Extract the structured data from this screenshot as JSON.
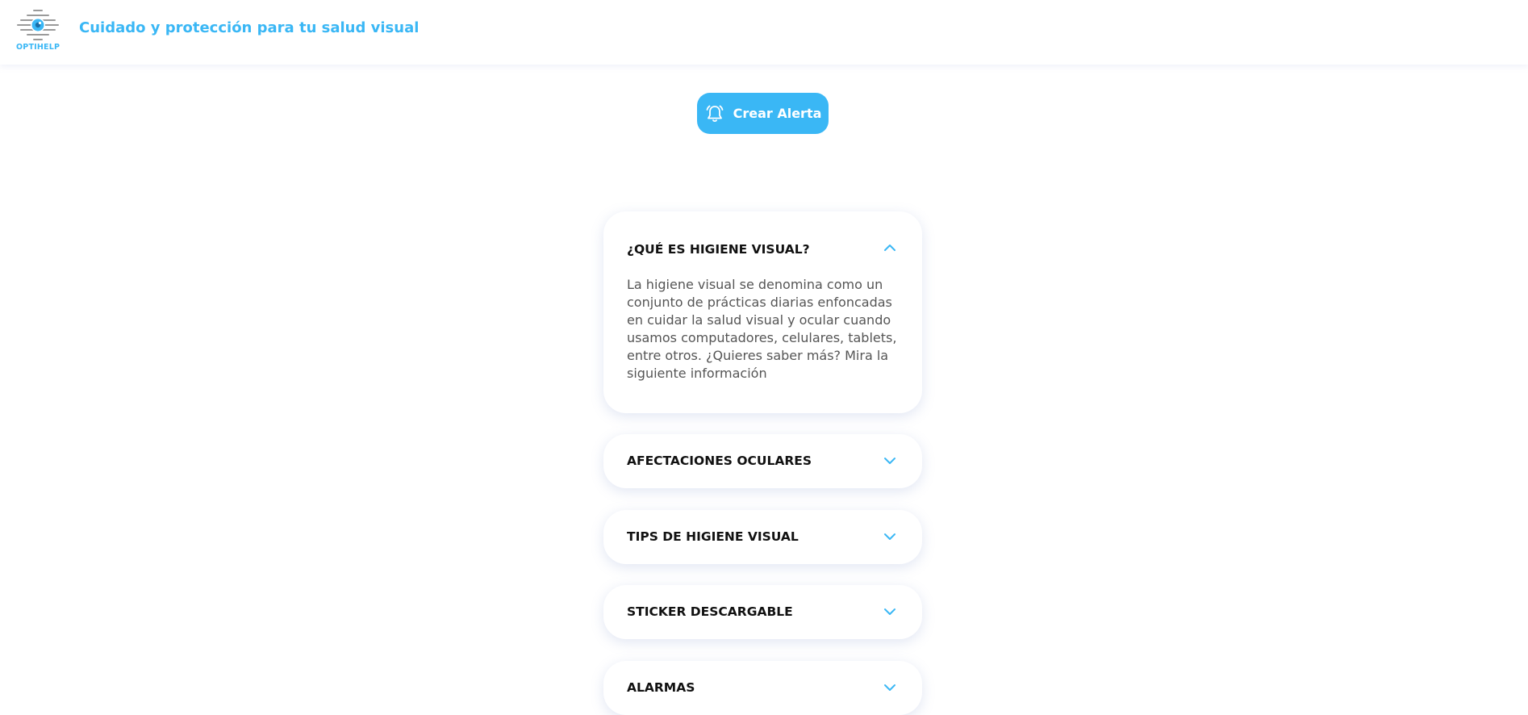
{
  "header": {
    "logo_text": "OPTIHELP",
    "tagline": "Cuidado y protección para tu salud visual"
  },
  "alert_button": {
    "label": "Crear Alerta",
    "icon": "bell-icon"
  },
  "accordion": [
    {
      "title": "¿QUÉ ES HIGIENE VISUAL?",
      "expanded": true,
      "body": "La higiene visual se denomina como un conjunto de prácticas diarias enfoncadas en cuidar la salud visual y ocular cuando usamos computadores, celulares, tablets, entre otros. ¿Quieres saber más? Mira la siguiente información"
    },
    {
      "title": "AFECTACIONES OCULARES",
      "expanded": false
    },
    {
      "title": "TIPS DE HIGIENE VISUAL",
      "expanded": false
    },
    {
      "title": "STICKER DESCARGABLE",
      "expanded": false
    },
    {
      "title": "ALARMAS",
      "expanded": false
    }
  ],
  "colors": {
    "accent": "#3ab7f5",
    "text_dark": "#111111",
    "text_body": "#555555"
  }
}
